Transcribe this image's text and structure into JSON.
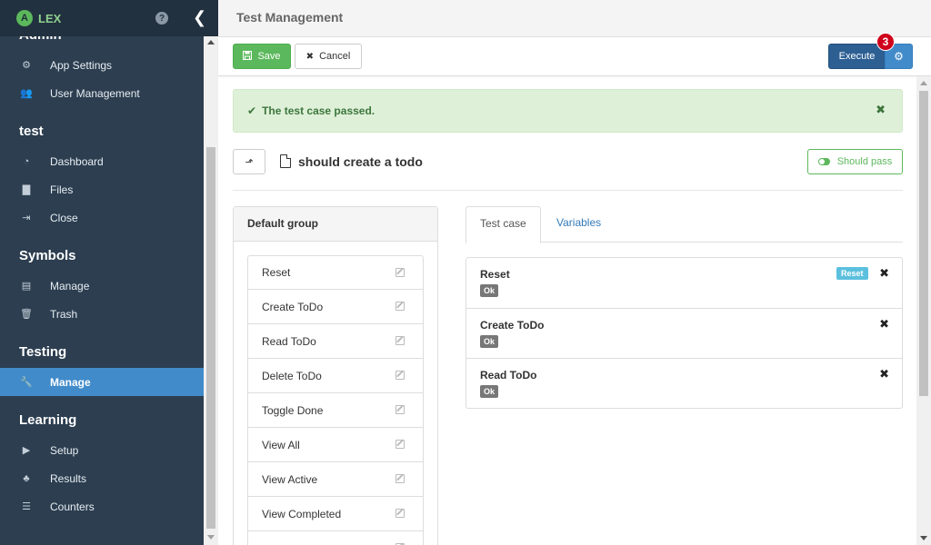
{
  "app": {
    "logo_letter": "A",
    "logo_text": "LEX",
    "help_glyph": "?",
    "collapse_glyph": "❮"
  },
  "sidebar": {
    "sections": [
      {
        "title": "Admin",
        "items": [
          {
            "label": "App Settings",
            "icon": "cogs-icon",
            "glyph": "⚙"
          },
          {
            "label": "User Management",
            "icon": "users-icon",
            "glyph": "👥"
          }
        ]
      },
      {
        "title": "test",
        "items": [
          {
            "label": "Dashboard",
            "icon": "dashboard-icon",
            "glyph": "◔"
          },
          {
            "label": "Files",
            "icon": "file-icon",
            "glyph": "▇"
          },
          {
            "label": "Close",
            "icon": "sign-out-icon",
            "glyph": "⇥"
          }
        ]
      },
      {
        "title": "Symbols",
        "items": [
          {
            "label": "Manage",
            "icon": "list-icon",
            "glyph": "▤"
          },
          {
            "label": "Trash",
            "icon": "trash-icon",
            "glyph": "🗑"
          }
        ]
      },
      {
        "title": "Testing",
        "items": [
          {
            "label": "Manage",
            "icon": "wrench-icon",
            "glyph": "🔧",
            "active": true
          }
        ]
      },
      {
        "title": "Learning",
        "items": [
          {
            "label": "Setup",
            "icon": "play-icon",
            "glyph": "▶"
          },
          {
            "label": "Results",
            "icon": "sitemap-icon",
            "glyph": "♣"
          },
          {
            "label": "Counters",
            "icon": "list-ol-icon",
            "glyph": "☰"
          }
        ]
      }
    ]
  },
  "header": {
    "title": "Test Management"
  },
  "toolbar": {
    "save_label": "Save",
    "cancel_label": "Cancel",
    "execute_label": "Execute",
    "execute_count": "3"
  },
  "alert": {
    "message": "The test case passed.",
    "check_glyph": "✔",
    "close_glyph": "✖"
  },
  "test": {
    "name": "should create a todo",
    "up_glyph": "⬏",
    "should_pass_label": "Should pass"
  },
  "group": {
    "title": "Default group",
    "symbols": [
      "Reset",
      "Create ToDo",
      "Read ToDo",
      "Delete ToDo",
      "Toggle Done",
      "View All",
      "View Active",
      "View Completed",
      ""
    ]
  },
  "tabs": [
    {
      "label": "Test case"
    },
    {
      "label": "Variables"
    }
  ],
  "steps": [
    {
      "name": "Reset",
      "result": "Ok",
      "tag": "Reset"
    },
    {
      "name": "Create ToDo",
      "result": "Ok"
    },
    {
      "name": "Read ToDo",
      "result": "Ok"
    }
  ],
  "colors": {
    "sidebar_bg": "#2c3e50",
    "active": "#428bca",
    "success": "#5cb85c",
    "execute": "#2d5f93",
    "badge": "#d0021b"
  }
}
